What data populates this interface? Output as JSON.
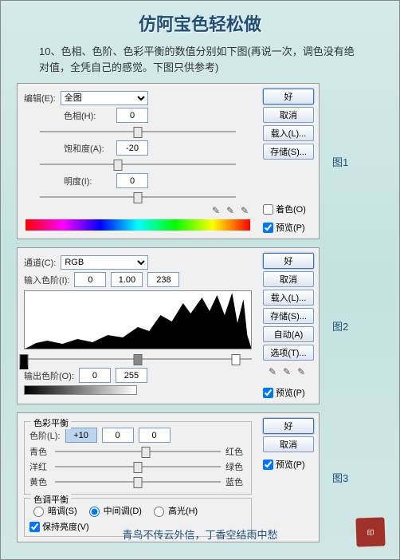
{
  "title": "仿阿宝色轻松做",
  "intro": "10、色相、色阶、色彩平衡的数值分别如下图(再说一次，调色没有绝对值，全凭自己的感觉。下图只供参考)",
  "figLabels": [
    "图1",
    "图2",
    "图3"
  ],
  "footer": "青鸟不传云外信，丁香空结雨中愁",
  "common": {
    "ok": "好",
    "cancel": "取消",
    "load": "载入(L)...",
    "save": "存储(S)...",
    "auto": "自动(A)",
    "options": "选项(T)...",
    "preview": "预览(P)",
    "colorize": "着色(O)"
  },
  "hsl": {
    "editLabel": "编辑(E):",
    "editValue": "全图",
    "hueLabel": "色相(H):",
    "hueVal": "0",
    "satLabel": "饱和度(A):",
    "satVal": "-20",
    "lightLabel": "明度(I):",
    "lightVal": "0"
  },
  "levels": {
    "channelLabel": "通道(C):",
    "channelValue": "RGB",
    "inputLabel": "输入色阶(I):",
    "inVals": [
      "0",
      "1.00",
      "238"
    ],
    "outputLabel": "输出色阶(O):",
    "outVals": [
      "0",
      "255"
    ]
  },
  "cb": {
    "title": "色彩平衡",
    "levelsLabel": "色阶(L):",
    "vals": [
      "+10",
      "0",
      "0"
    ],
    "left": [
      "青色",
      "洋红",
      "黄色"
    ],
    "right": [
      "红色",
      "绿色",
      "蓝色"
    ],
    "toneTitle": "色调平衡",
    "shadows": "暗调(S)",
    "midtones": "中间调(D)",
    "highlights": "高光(H)",
    "preserve": "保持亮度(V)"
  }
}
